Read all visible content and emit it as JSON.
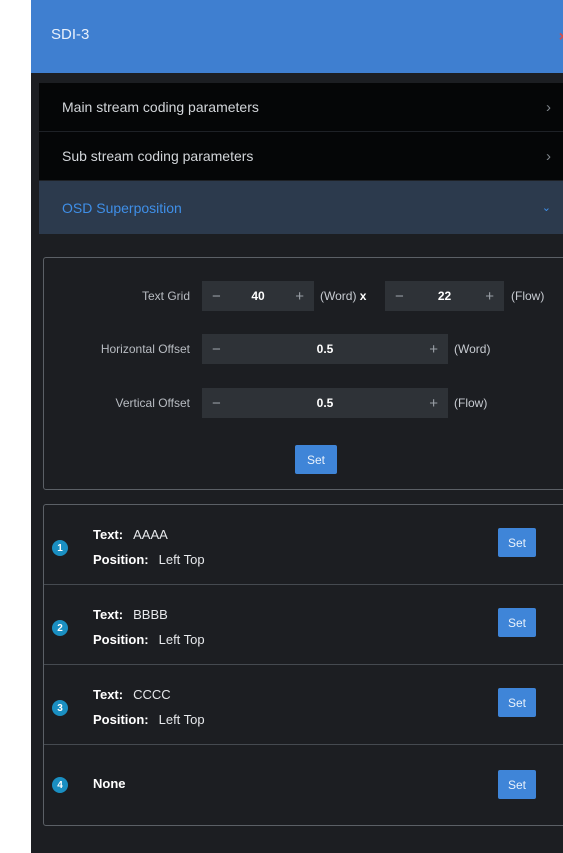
{
  "window": {
    "title": "SDI-3",
    "close_glyph": "×"
  },
  "accordion": [
    {
      "label": "Main stream coding parameters",
      "chevron": "›"
    },
    {
      "label": "Sub stream coding parameters",
      "chevron": "›"
    },
    {
      "label": "OSD Superposition",
      "chevron": "⌄"
    }
  ],
  "osd_grid": {
    "text_grid": {
      "label": "Text Grid",
      "cols": "40",
      "cols_unit": "(Word)",
      "times": "x",
      "rows": "22",
      "rows_unit": "(Flow)"
    },
    "horizontal_offset": {
      "label": "Horizontal Offset",
      "value": "0.5",
      "unit": "(Word)"
    },
    "vertical_offset": {
      "label": "Vertical Offset",
      "value": "0.5",
      "unit": "(Flow)"
    },
    "minus": "−",
    "plus": "+",
    "set_label": "Set"
  },
  "osd_items": [
    {
      "index": "1",
      "text_label": "Text:",
      "text_value": "AAAA",
      "pos_label": "Position:",
      "pos_value": "Left Top",
      "set_label": "Set"
    },
    {
      "index": "2",
      "text_label": "Text:",
      "text_value": "BBBB",
      "pos_label": "Position:",
      "pos_value": "Left Top",
      "set_label": "Set"
    },
    {
      "index": "3",
      "text_label": "Text:",
      "text_value": "CCCC",
      "pos_label": "Position:",
      "pos_value": "Left Top",
      "set_label": "Set"
    },
    {
      "index": "4",
      "none_label": "None",
      "set_label": "Set"
    }
  ],
  "colors": {
    "accent": "#3f85d8",
    "title_bar": "#3f7fd0",
    "badge": "#1a8fc2",
    "background": "#1c1e22"
  }
}
